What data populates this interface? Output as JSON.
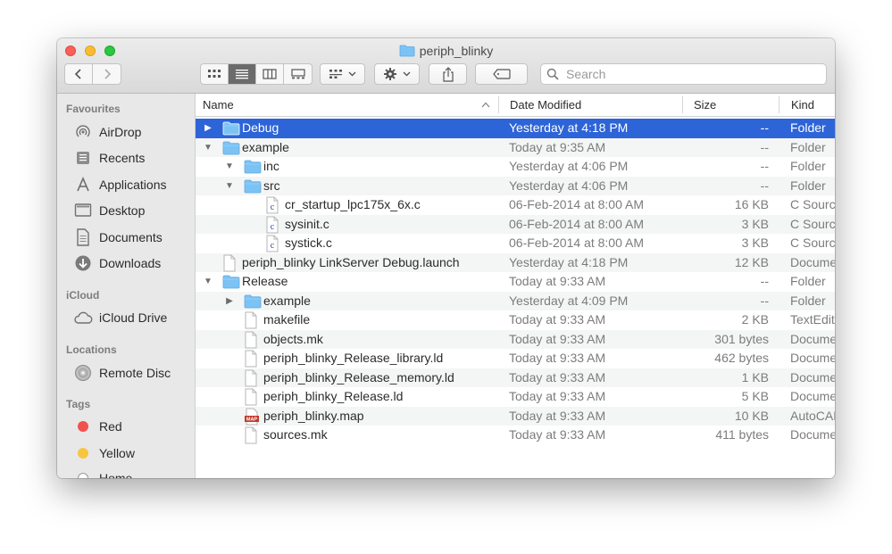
{
  "window": {
    "title": "periph_blinky"
  },
  "toolbar": {
    "search_placeholder": "Search"
  },
  "sidebar": {
    "favourites_header": "Favourites",
    "favourites": [
      {
        "label": "AirDrop",
        "icon": "airdrop-icon"
      },
      {
        "label": "Recents",
        "icon": "recents-icon"
      },
      {
        "label": "Applications",
        "icon": "applications-icon"
      },
      {
        "label": "Desktop",
        "icon": "desktop-icon"
      },
      {
        "label": "Documents",
        "icon": "documents-icon"
      },
      {
        "label": "Downloads",
        "icon": "downloads-icon"
      }
    ],
    "icloud_header": "iCloud",
    "icloud": [
      {
        "label": "iCloud Drive",
        "icon": "cloud-icon"
      }
    ],
    "locations_header": "Locations",
    "locations": [
      {
        "label": "Remote Disc",
        "icon": "disc-icon"
      }
    ],
    "tags_header": "Tags",
    "tags": [
      {
        "label": "Red",
        "color": "#f0524d"
      },
      {
        "label": "Yellow",
        "color": "#f7c640"
      },
      {
        "label": "Home",
        "color": "#ffffff"
      }
    ]
  },
  "columns": {
    "name": "Name",
    "date": "Date Modified",
    "size": "Size",
    "kind": "Kind"
  },
  "files": [
    {
      "name": "Debug",
      "date": "Yesterday at 4:18 PM",
      "size": "--",
      "kind": "Folder",
      "depth": 0,
      "type": "folder",
      "disclosure": "collapsed",
      "selected": true
    },
    {
      "name": "example",
      "date": "Today at 9:35 AM",
      "size": "--",
      "kind": "Folder",
      "depth": 0,
      "type": "folder",
      "disclosure": "expanded"
    },
    {
      "name": "inc",
      "date": "Yesterday at 4:06 PM",
      "size": "--",
      "kind": "Folder",
      "depth": 1,
      "type": "folder",
      "disclosure": "expanded"
    },
    {
      "name": "src",
      "date": "Yesterday at 4:06 PM",
      "size": "--",
      "kind": "Folder",
      "depth": 1,
      "type": "folder",
      "disclosure": "expanded"
    },
    {
      "name": "cr_startup_lpc175x_6x.c",
      "date": "06-Feb-2014 at 8:00 AM",
      "size": "16 KB",
      "kind": "C Source",
      "depth": 2,
      "type": "c-file"
    },
    {
      "name": "sysinit.c",
      "date": "06-Feb-2014 at 8:00 AM",
      "size": "3 KB",
      "kind": "C Source",
      "depth": 2,
      "type": "c-file"
    },
    {
      "name": "systick.c",
      "date": "06-Feb-2014 at 8:00 AM",
      "size": "3 KB",
      "kind": "C Source",
      "depth": 2,
      "type": "c-file"
    },
    {
      "name": "periph_blinky LinkServer Debug.launch",
      "date": "Yesterday at 4:18 PM",
      "size": "12 KB",
      "kind": "Document",
      "depth": 0,
      "type": "document"
    },
    {
      "name": "Release",
      "date": "Today at 9:33 AM",
      "size": "--",
      "kind": "Folder",
      "depth": 0,
      "type": "folder",
      "disclosure": "expanded"
    },
    {
      "name": "example",
      "date": "Yesterday at 4:09 PM",
      "size": "--",
      "kind": "Folder",
      "depth": 1,
      "type": "folder",
      "disclosure": "collapsed"
    },
    {
      "name": "makefile",
      "date": "Today at 9:33 AM",
      "size": "2 KB",
      "kind": "TextEdit",
      "depth": 1,
      "type": "document"
    },
    {
      "name": "objects.mk",
      "date": "Today at 9:33 AM",
      "size": "301 bytes",
      "kind": "Document",
      "depth": 1,
      "type": "document"
    },
    {
      "name": "periph_blinky_Release_library.ld",
      "date": "Today at 9:33 AM",
      "size": "462 bytes",
      "kind": "Document",
      "depth": 1,
      "type": "document"
    },
    {
      "name": "periph_blinky_Release_memory.ld",
      "date": "Today at 9:33 AM",
      "size": "1 KB",
      "kind": "Document",
      "depth": 1,
      "type": "document"
    },
    {
      "name": "periph_blinky_Release.ld",
      "date": "Today at 9:33 AM",
      "size": "5 KB",
      "kind": "Document",
      "depth": 1,
      "type": "document"
    },
    {
      "name": "periph_blinky.map",
      "date": "Today at 9:33 AM",
      "size": "10 KB",
      "kind": "AutoCAD",
      "depth": 1,
      "type": "map-file",
      "badge": "MAP"
    },
    {
      "name": "sources.mk",
      "date": "Today at 9:33 AM",
      "size": "411 bytes",
      "kind": "Document",
      "depth": 1,
      "type": "document"
    }
  ]
}
